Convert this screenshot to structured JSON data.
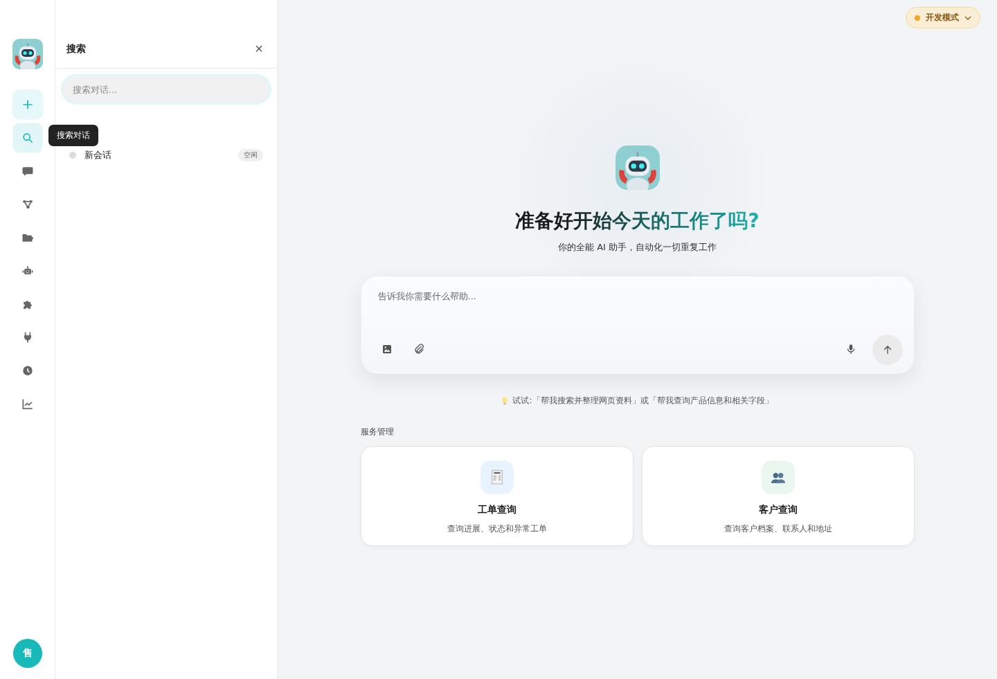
{
  "rail": {
    "items": [
      {
        "kind": "new"
      },
      {
        "kind": "search",
        "selected": true
      },
      {
        "kind": "chat",
        "selected": false
      },
      {
        "kind": "flow",
        "selected": false
      },
      {
        "kind": "folder",
        "selected": false
      },
      {
        "kind": "robot",
        "selected": false
      },
      {
        "kind": "puzzle",
        "selected": false
      },
      {
        "kind": "plug",
        "selected": false
      },
      {
        "kind": "clock",
        "selected": false
      },
      {
        "kind": "chart",
        "selected": false
      }
    ],
    "tooltip": "搜索对话",
    "avatar": "售"
  },
  "panel": {
    "title": "搜索",
    "close": "×",
    "search": {
      "placeholder": "搜索对话..."
    },
    "sessions": [
      {
        "title": "新会话",
        "status": "空闲",
        "color": "#dddddd"
      }
    ]
  },
  "mode": {
    "label": "开发模式",
    "color": "#f5a623"
  },
  "hero": {
    "title": "准备好开始今天的工作了吗?",
    "subtitle": "你的全能 AI 助手，自动化一切重复工作"
  },
  "composer": {
    "placeholder": "告诉我你需要什么帮助..."
  },
  "hint": "试试:「帮我搜索并整理网页资料」或「帮我查询产品信息和相关字段」",
  "section": "服务管理",
  "cards": [
    {
      "kind": "receipt",
      "title": "工单查询",
      "desc": "查询进展、状态和异常工单"
    },
    {
      "kind": "people",
      "title": "客户查询",
      "desc": "查询客户档案、联系人和地址"
    }
  ]
}
